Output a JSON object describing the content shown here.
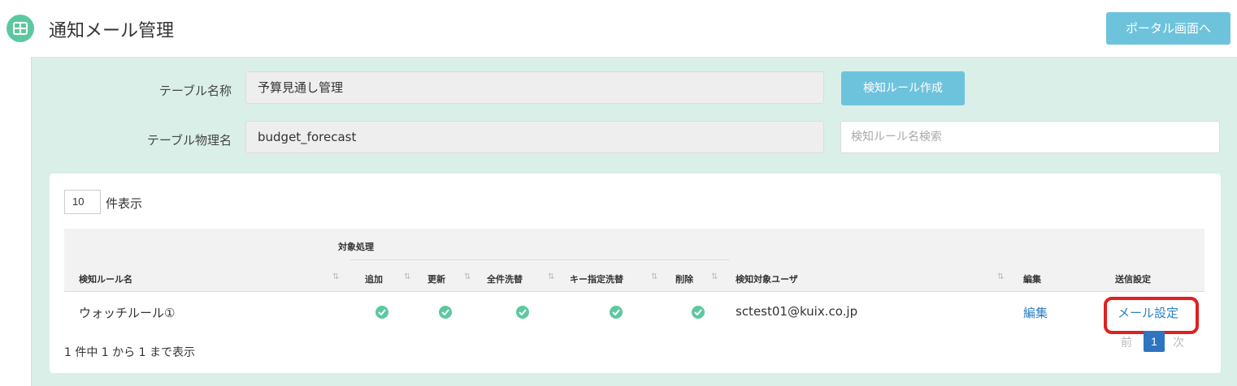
{
  "header": {
    "title": "通知メール管理",
    "portal_button": "ポータル画面へ",
    "icon": "grid-icon",
    "accent_color": "#5cc8a0"
  },
  "form": {
    "table_name_label": "テーブル名称",
    "table_name_value": "予算見通し管理",
    "table_physical_label": "テーブル物理名",
    "table_physical_value": "budget_forecast",
    "create_rule_button": "検知ルール作成",
    "rule_search_placeholder": "検知ルール名検索"
  },
  "list": {
    "page_size": "10",
    "page_size_label": "件表示",
    "group_header": "対象処理",
    "columns": {
      "rule_name": "検知ルール名",
      "add": "追加",
      "update": "更新",
      "full_replace": "全件洗替",
      "key_replace": "キー指定洗替",
      "delete": "削除",
      "target_user": "検知対象ユーザ",
      "edit": "編集",
      "send_settings": "送信設定"
    },
    "rows": [
      {
        "rule_name": "ウォッチルール①",
        "add": true,
        "update": true,
        "full_replace": true,
        "key_replace": true,
        "delete": true,
        "target_user": "sctest01@kuix.co.jp",
        "edit_link": "編集",
        "mail_link": "メール設定"
      }
    ],
    "info": "1 件中 1 から 1 まで表示",
    "pager": {
      "prev": "前",
      "current": "1",
      "next": "次"
    }
  },
  "colors": {
    "panel_bg": "#d9efe8",
    "button_bg": "#6ec3dc",
    "link": "#2a7fc1",
    "highlight": "#e02020"
  }
}
